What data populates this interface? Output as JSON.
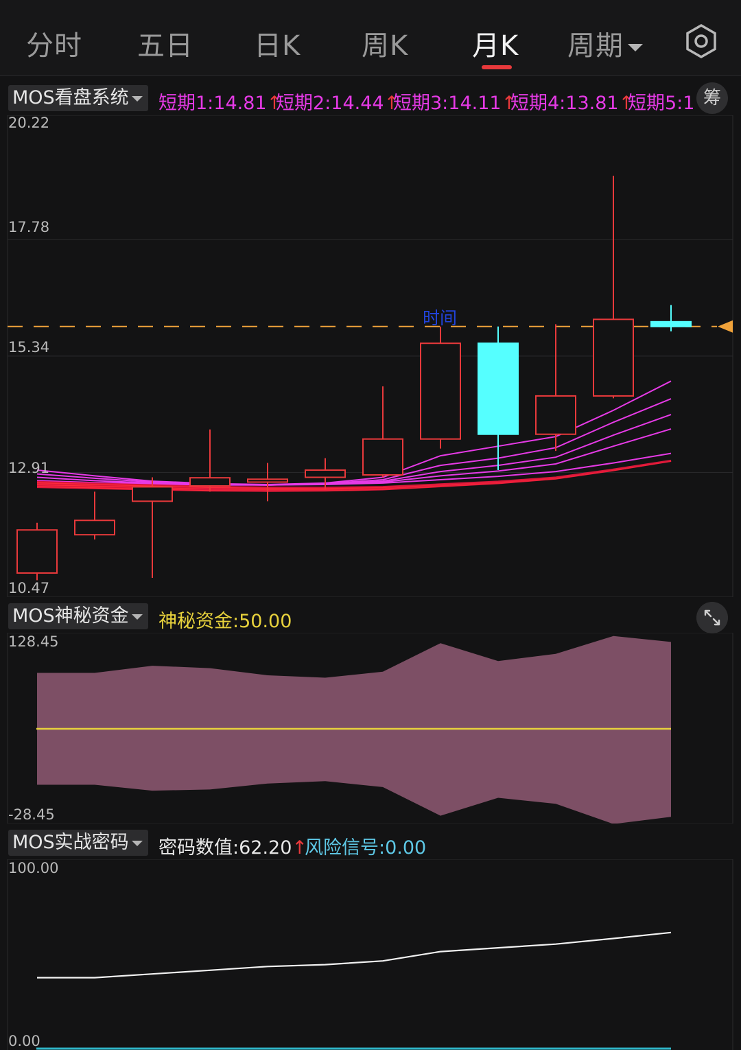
{
  "tabs": [
    {
      "label": "分时",
      "active": false
    },
    {
      "label": "五日",
      "active": false
    },
    {
      "label": "日K",
      "active": false
    },
    {
      "label": "周K",
      "active": false
    },
    {
      "label": "月K",
      "active": true
    },
    {
      "label": "周期",
      "active": false
    }
  ],
  "settings_icon": "gear-icon",
  "main_panel": {
    "indicator_select": "MOS看盘系统",
    "indicators": [
      {
        "label": "短期1:14.81",
        "arrow": "↑"
      },
      {
        "label": "短期2:14.44",
        "arrow": "↑"
      },
      {
        "label": "短期3:14.11",
        "arrow": "↑"
      },
      {
        "label": "短期4:13.81",
        "arrow": "↑"
      },
      {
        "label": "短期5:1",
        "arrow": ""
      }
    ],
    "chip_button": "筹",
    "marker_text": "时间",
    "y_labels": [
      "20.22",
      "17.78",
      "15.34",
      "12.91",
      "10.47"
    ]
  },
  "panel2": {
    "indicator_select": "MOS神秘资金",
    "value_label": "神秘资金:50.00",
    "y_top": "128.45",
    "y_bottom": "-28.45",
    "expand_icon": "expand-icon"
  },
  "panel3": {
    "indicator_select": "MOS实战密码",
    "value_label": "密码数值:62.20",
    "value_arrow": "↑",
    "risk_label": "风险信号:0.00",
    "y_top": "100.00",
    "y_bottom": "0.00"
  },
  "colors": {
    "up": "#e8393b",
    "down": "#55ffff",
    "ma": "#e63ae6",
    "yellow": "#e8d23c",
    "fill": "#7d4f65",
    "price_line": "#f0a23a"
  },
  "chart_data": [
    {
      "type": "candlestick",
      "period": "monthly",
      "ylim": [
        10.47,
        20.22
      ],
      "candles": [
        {
          "open": 10.8,
          "close": 11.7,
          "high": 11.85,
          "low": 10.65
        },
        {
          "open": 11.6,
          "close": 11.9,
          "high": 12.5,
          "low": 11.5
        },
        {
          "open": 12.3,
          "close": 12.6,
          "high": 12.8,
          "low": 10.7
        },
        {
          "open": 12.62,
          "close": 12.79,
          "high": 13.8,
          "low": 12.5
        },
        {
          "open": 12.7,
          "close": 12.76,
          "high": 13.1,
          "low": 12.3
        },
        {
          "open": 12.8,
          "close": 12.95,
          "high": 13.2,
          "low": 12.55
        },
        {
          "open": 12.85,
          "close": 13.6,
          "high": 14.7,
          "low": 12.8
        },
        {
          "open": 13.6,
          "close": 15.6,
          "high": 15.95,
          "low": 13.4
        },
        {
          "open": 15.6,
          "close": 13.7,
          "high": 15.95,
          "low": 12.95
        },
        {
          "open": 13.7,
          "close": 14.5,
          "high": 16.0,
          "low": 13.35
        },
        {
          "open": 14.5,
          "close": 16.1,
          "high": 19.1,
          "low": 14.45
        },
        {
          "open": 16.05,
          "close": 15.95,
          "high": 16.4,
          "low": 15.85
        }
      ],
      "current_price": 15.95,
      "moving_averages": [
        {
          "name": "短期1",
          "values": [
            12.95,
            12.83,
            12.72,
            12.67,
            12.65,
            12.68,
            12.8,
            13.25,
            13.45,
            13.65,
            14.2,
            14.81
          ]
        },
        {
          "name": "短期2",
          "values": [
            12.87,
            12.78,
            12.7,
            12.66,
            12.64,
            12.67,
            12.75,
            13.05,
            13.2,
            13.42,
            13.95,
            14.44
          ]
        },
        {
          "name": "短期3",
          "values": [
            12.8,
            12.73,
            12.68,
            12.65,
            12.64,
            12.66,
            12.72,
            12.92,
            13.05,
            13.22,
            13.68,
            14.11
          ]
        },
        {
          "name": "短期4",
          "values": [
            12.73,
            12.69,
            12.67,
            12.65,
            12.64,
            12.66,
            12.7,
            12.83,
            12.93,
            13.08,
            13.45,
            13.81
          ]
        },
        {
          "name": "短期5",
          "values": [
            12.7,
            12.68,
            12.66,
            12.64,
            12.64,
            12.65,
            12.68,
            12.75,
            12.82,
            12.92,
            13.1,
            13.3
          ]
        }
      ]
    },
    {
      "type": "area",
      "name": "MOS神秘资金",
      "ylim": [
        -28.45,
        128.45
      ],
      "upper": [
        97,
        97,
        103,
        101,
        95,
        93,
        98,
        122,
        107,
        113,
        128,
        123
      ],
      "lower": [
        3,
        3,
        -2,
        -1,
        4,
        6,
        1,
        -23,
        -8,
        -13,
        -30,
        -24
      ],
      "level": 50
    },
    {
      "type": "line",
      "name": "MOS实战密码",
      "ylim": [
        0,
        100
      ],
      "values": [
        38,
        38,
        40,
        42,
        44,
        45,
        47,
        52,
        54,
        56,
        59,
        62.2
      ]
    }
  ]
}
